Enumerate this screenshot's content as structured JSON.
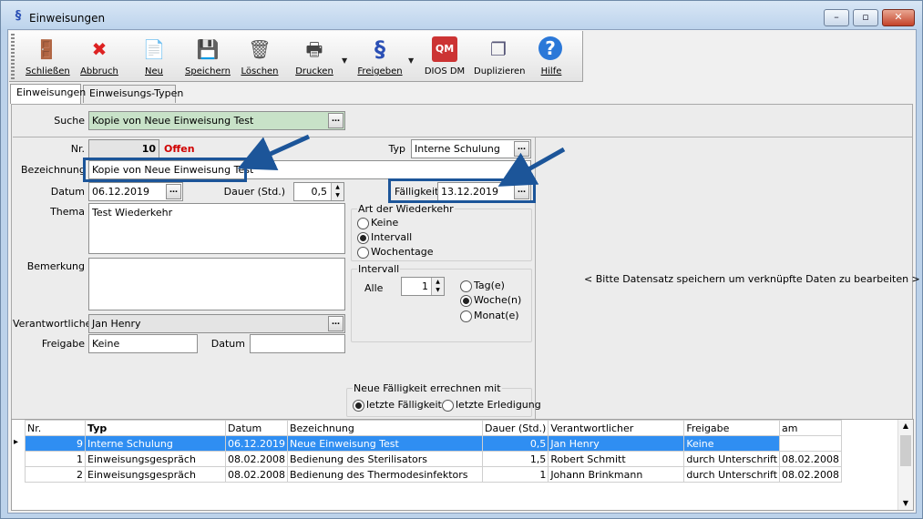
{
  "window": {
    "title": "Einweisungen",
    "min": "–",
    "max": "▫",
    "close": "✕"
  },
  "toolbar": [
    {
      "label": "Schließen",
      "icon": "door-exit-icon",
      "glyph": "🚪"
    },
    {
      "label": "Abbruch",
      "icon": "cancel-icon",
      "glyph": "✖"
    },
    {
      "label": "Neu",
      "icon": "new-page-icon",
      "glyph": "📄"
    },
    {
      "label": "Speichern",
      "icon": "save-icon",
      "glyph": "💾"
    },
    {
      "label": "Löschen",
      "icon": "trash-icon",
      "glyph": "🗑"
    },
    {
      "label": "Drucken",
      "icon": "printer-icon",
      "glyph": "🖶"
    },
    {
      "label": "Freigeben",
      "icon": "paragraph-icon",
      "glyph": "§"
    },
    {
      "label": "DIOS DM",
      "icon": "qm-document-icon",
      "glyph": "QM"
    },
    {
      "label": "Duplizieren",
      "icon": "duplicate-icon",
      "glyph": "❐"
    },
    {
      "label": "Hilfe",
      "icon": "help-icon",
      "glyph": "?"
    }
  ],
  "tabs": [
    "Einweisungen",
    "Einweisungs-Typen"
  ],
  "search": {
    "label": "Suche",
    "value": "Kopie von Neue Einweisung Test"
  },
  "form": {
    "nr_label": "Nr.",
    "nr_value": "10",
    "status": "Offen",
    "status_color": "#d00000",
    "typ_label": "Typ",
    "typ_value": "Interne Schulung",
    "bez_label": "Bezeichnung",
    "bez_value": "Kopie von Neue Einweisung Test",
    "datum_label": "Datum",
    "datum_value": "06.12.2019",
    "dauer_label": "Dauer (Std.)",
    "dauer_value": "0,5",
    "faell_label": "Fälligkeit",
    "faell_value": "13.12.2019",
    "thema_label": "Thema",
    "thema_value": "Test Wiederkehr",
    "bem_label": "Bemerkung",
    "bem_value": "",
    "verant_label": "Verantwortlicher",
    "verant_value": "Jan Henry",
    "freigabe_label": "Freigabe",
    "freigabe_value": "Keine",
    "datum2_label": "Datum",
    "datum2_value": ""
  },
  "wiederkehr": {
    "caption": "Art der Wiederkehr",
    "options": [
      "Keine",
      "Intervall",
      "Wochentage"
    ],
    "selected": "Intervall"
  },
  "intervall": {
    "caption": "Intervall",
    "alle_label": "Alle",
    "alle_value": "1",
    "units": [
      "Tag(e)",
      "Woche(n)",
      "Monat(e)"
    ],
    "selected": "Woche(n)"
  },
  "neue": {
    "caption": "Neue Fälligkeit errechnen mit",
    "options": [
      "letzte Fälligkeit",
      "letzte Erledigung"
    ],
    "selected": "letzte Fälligkeit"
  },
  "linked_msg": "< Bitte Datensatz speichern um verknüpfte Daten zu bearbeiten >",
  "table": {
    "columns": [
      "Nr.",
      "Typ",
      "Datum",
      "Bezeichnung",
      "Dauer (Std.)",
      "Verantwortlicher",
      "Freigabe",
      "am"
    ],
    "rows": [
      [
        "9",
        "Interne Schulung",
        "06.12.2019",
        "Neue Einweisung Test",
        "0,5",
        "Jan Henry",
        "Keine",
        ""
      ],
      [
        "1",
        "Einweisungsgespräch",
        "08.02.2008",
        "Bedienung des Sterilisators",
        "1,5",
        "Robert Schmitt",
        "durch Unterschrift",
        "08.02.2008"
      ],
      [
        "2",
        "Einweisungsgespräch",
        "08.02.2008",
        "Bedienung des Thermodesinfektors",
        "1",
        "Johann Brinkmann",
        "durch Unterschrift",
        "08.02.2008"
      ]
    ],
    "current_marker": "▸"
  },
  "colors": {
    "accent": "#1c5599",
    "selection": "#2f8ef2",
    "search_bg": "#c8e2c8"
  }
}
